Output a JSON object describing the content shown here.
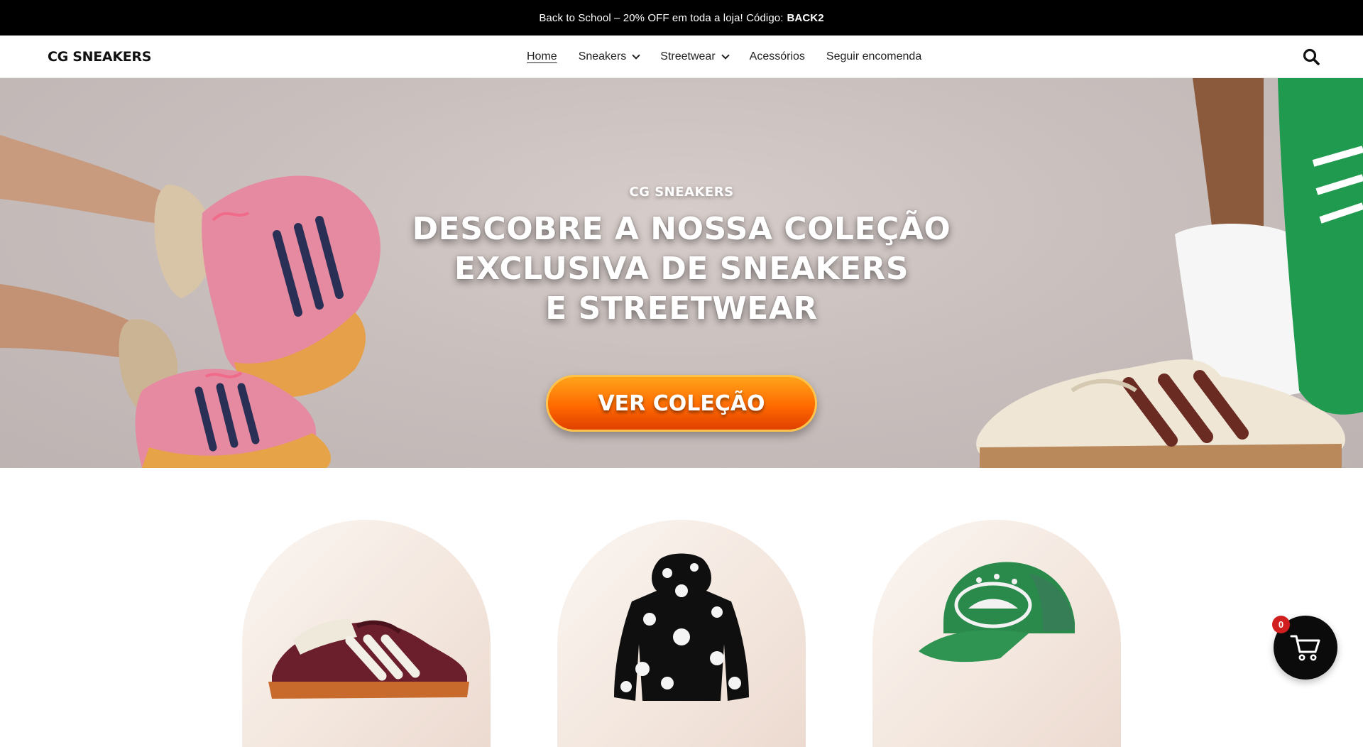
{
  "announcement": {
    "text": "Back to School – 20% OFF em toda a loja! Código:",
    "code": "BACK2"
  },
  "header": {
    "logo": "CG SNEAKERS",
    "nav": [
      {
        "label": "Home",
        "active": true,
        "dropdown": false
      },
      {
        "label": "Sneakers",
        "active": false,
        "dropdown": true
      },
      {
        "label": "Streetwear",
        "active": false,
        "dropdown": true
      },
      {
        "label": "Acessórios",
        "active": false,
        "dropdown": false
      },
      {
        "label": "Seguir encomenda",
        "active": false,
        "dropdown": false
      }
    ],
    "search_icon": "search-icon"
  },
  "hero": {
    "brand": "CG SNEAKERS",
    "title_line1": "DESCOBRE A NOSSA COLEÇÃO",
    "title_line2": "EXCLUSIVA DE SNEAKERS",
    "title_line3": "E STREETWEAR",
    "cta": "VER COLEÇÃO"
  },
  "categories": [
    {
      "icon": "sneaker-icon"
    },
    {
      "icon": "hoodie-icon"
    },
    {
      "icon": "cap-icon"
    }
  ],
  "cart": {
    "count": "0",
    "icon": "cart-icon"
  },
  "colors": {
    "announcement_bg": "#000000",
    "cta_orange": "#ff6a00",
    "badge_red": "#d11f1f",
    "cart_bg": "#0b0b0b"
  }
}
